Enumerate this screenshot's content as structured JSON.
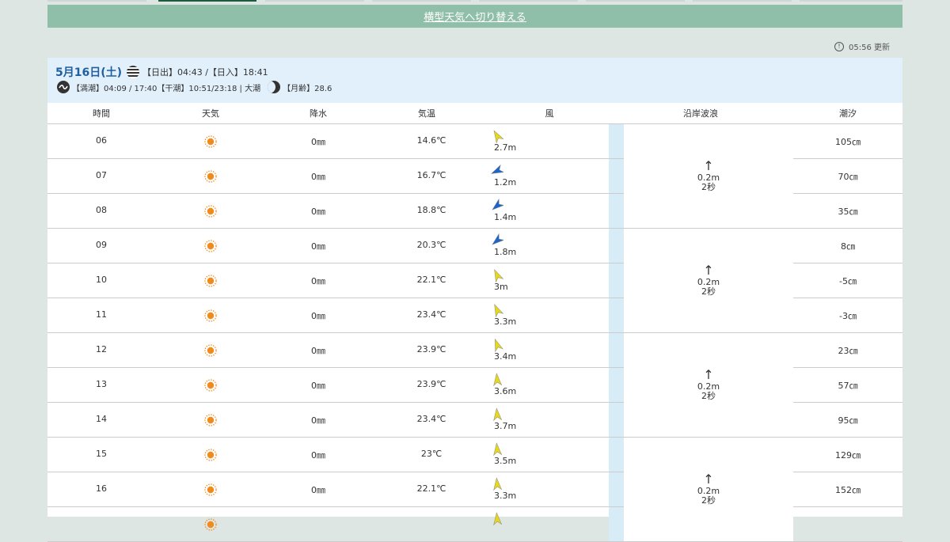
{
  "switch_link": "横型天気へ切り替える",
  "update_text": "05:56 更新",
  "date": {
    "title": "5月16日(土)",
    "sun_text": "【日出】04:43 /【日入】18:41",
    "tide_text": "【満潮】04:09 / 17:40【干潮】10:51/23:18 | 大潮",
    "moon_text": "【月齢】28.6"
  },
  "columns": [
    "時間",
    "天気",
    "降水",
    "気温",
    "風",
    "沿岸波浪",
    "潮汐"
  ],
  "rows": [
    {
      "hour": "06",
      "weather": "sun-icon",
      "rain": "0㎜",
      "temp": "14.6℃",
      "wind_speed": "2.7m",
      "wind_dir_deg": 150,
      "wind_color": "#e8d81a",
      "tide": "105㎝"
    },
    {
      "hour": "07",
      "weather": "sun-icon",
      "rain": "0㎜",
      "temp": "16.7℃",
      "wind_speed": "1.2m",
      "wind_dir_deg": 65,
      "wind_color": "#1d65c8",
      "tide": "70㎝"
    },
    {
      "hour": "08",
      "weather": "sun-icon",
      "rain": "0㎜",
      "temp": "18.8℃",
      "wind_speed": "1.4m",
      "wind_dir_deg": 50,
      "wind_color": "#1d65c8",
      "tide": "35㎝"
    },
    {
      "hour": "09",
      "weather": "sun-icon",
      "rain": "0㎜",
      "temp": "20.3℃",
      "wind_speed": "1.8m",
      "wind_dir_deg": 50,
      "wind_color": "#1d65c8",
      "tide": "8㎝"
    },
    {
      "hour": "10",
      "weather": "sun-icon",
      "rain": "0㎜",
      "temp": "22.1℃",
      "wind_speed": "3m",
      "wind_dir_deg": 155,
      "wind_color": "#e8d81a",
      "tide": "-5㎝"
    },
    {
      "hour": "11",
      "weather": "sun-icon",
      "rain": "0㎜",
      "temp": "23.4℃",
      "wind_speed": "3.3m",
      "wind_dir_deg": 155,
      "wind_color": "#e8d81a",
      "tide": "-3㎝"
    },
    {
      "hour": "12",
      "weather": "sun-icon",
      "rain": "0㎜",
      "temp": "23.9℃",
      "wind_speed": "3.4m",
      "wind_dir_deg": 160,
      "wind_color": "#e8d81a",
      "tide": "23㎝"
    },
    {
      "hour": "13",
      "weather": "sun-icon",
      "rain": "0㎜",
      "temp": "23.9℃",
      "wind_speed": "3.6m",
      "wind_dir_deg": 175,
      "wind_color": "#e8d81a",
      "tide": "57㎝"
    },
    {
      "hour": "14",
      "weather": "sun-icon",
      "rain": "0㎜",
      "temp": "23.4℃",
      "wind_speed": "3.7m",
      "wind_dir_deg": 175,
      "wind_color": "#e8d81a",
      "tide": "95㎝"
    },
    {
      "hour": "15",
      "weather": "sun-icon",
      "rain": "0㎜",
      "temp": "23℃",
      "wind_speed": "3.5m",
      "wind_dir_deg": 175,
      "wind_color": "#e8d81a",
      "tide": "129㎝"
    },
    {
      "hour": "16",
      "weather": "sun-icon",
      "rain": "0㎜",
      "temp": "22.1℃",
      "wind_speed": "3.3m",
      "wind_dir_deg": 175,
      "wind_color": "#e8d81a",
      "tide": "152㎝"
    },
    {
      "hour": "",
      "weather": "sun-icon",
      "rain": "",
      "temp": "",
      "wind_speed": "",
      "wind_dir_deg": 175,
      "wind_color": "#e8d81a",
      "tide": ""
    }
  ],
  "waves": [
    {
      "height": "0.2m",
      "period": "2秒"
    },
    {
      "height": "0.2m",
      "period": "2秒"
    },
    {
      "height": "0.2m",
      "period": "2秒"
    },
    {
      "height": "0.2m",
      "period": "2秒"
    }
  ]
}
